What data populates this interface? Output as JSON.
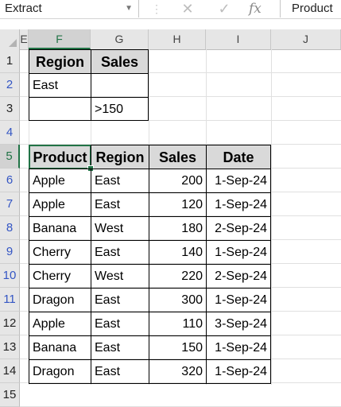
{
  "formula_bar": {
    "name_box": "Extract",
    "name_box_dropdown_icon": "chevron-down-icon",
    "cancel_icon": "✕",
    "enter_icon": "✓",
    "fx_label": "fx",
    "content": "Product"
  },
  "columns": [
    "E",
    "F",
    "G",
    "H",
    "I",
    "J"
  ],
  "rows": [
    "1",
    "2",
    "3",
    "4",
    "5",
    "6",
    "7",
    "8",
    "9",
    "10",
    "11",
    "12",
    "13",
    "14",
    "15"
  ],
  "criteria": {
    "headers": [
      "Region",
      "Sales"
    ],
    "rows": [
      [
        "East",
        ""
      ],
      [
        "",
        ">150"
      ]
    ]
  },
  "table": {
    "headers": [
      "Product",
      "Region",
      "Sales",
      "Date"
    ],
    "rows": [
      [
        "Apple",
        "East",
        "200",
        "1-Sep-24"
      ],
      [
        "Apple",
        "East",
        "120",
        "1-Sep-24"
      ],
      [
        "Banana",
        "West",
        "180",
        "2-Sep-24"
      ],
      [
        "Cherry",
        "East",
        "140",
        "1-Sep-24"
      ],
      [
        "Cherry",
        "West",
        "220",
        "2-Sep-24"
      ],
      [
        "Dragon",
        "East",
        "300",
        "1-Sep-24"
      ],
      [
        "Apple",
        "East",
        "110",
        "3-Sep-24"
      ],
      [
        "Banana",
        "East",
        "150",
        "1-Sep-24"
      ],
      [
        "Dragon",
        "East",
        "320",
        "1-Sep-24"
      ]
    ]
  },
  "colors": {
    "accent": "#217346",
    "row_number_blue": "#3456c4",
    "header_fill": "#d9d9d9"
  }
}
